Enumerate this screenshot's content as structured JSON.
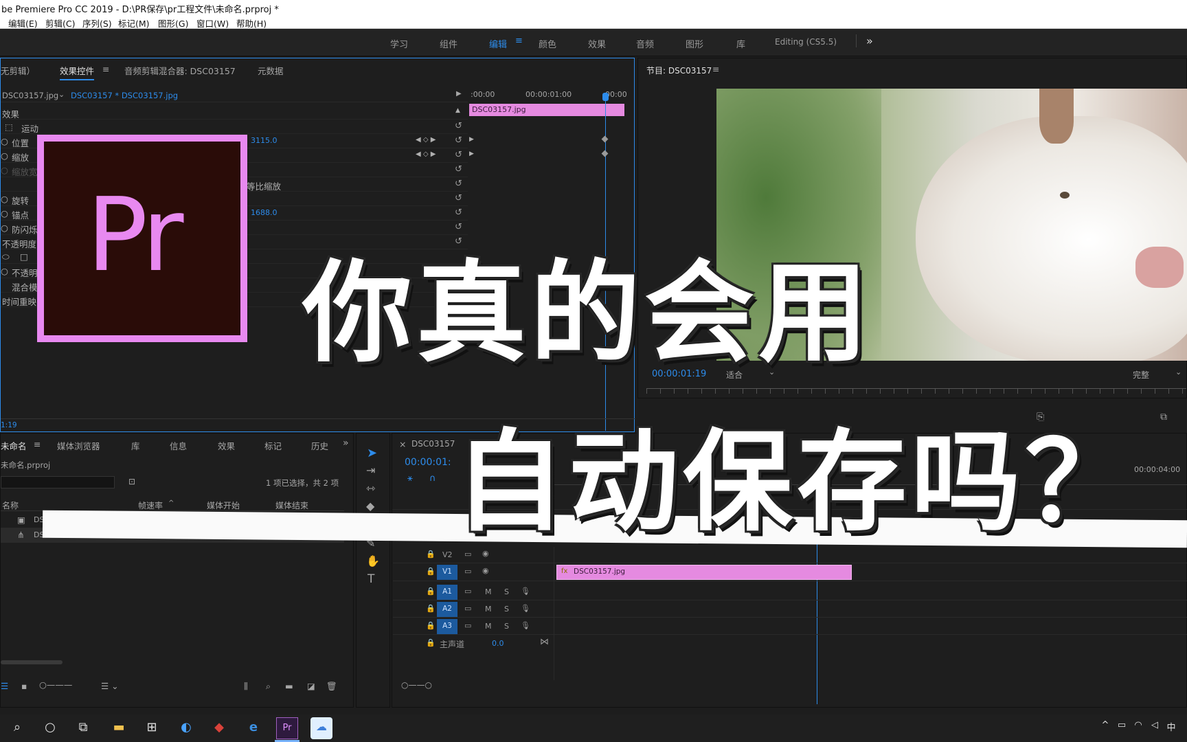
{
  "window": {
    "title": "be Premiere Pro CC 2019 - D:\\PR保存\\pr工程文件\\未命名.prproj *"
  },
  "menu": [
    "编辑(E)",
    "剪辑(C)",
    "序列(S)",
    "标记(M)",
    "图形(G)",
    "窗口(W)",
    "帮助(H)"
  ],
  "workspaces": [
    "学习",
    "组件",
    "编辑",
    "颜色",
    "效果",
    "音频",
    "图形",
    "库",
    "Editing (CS5.5)"
  ],
  "effect_panel": {
    "tabs": [
      "无剪辑）",
      "效果控件",
      "音频剪辑混合器: DSC03157",
      "元数据"
    ],
    "source": "DSC03157.jpg",
    "clip": "DSC03157 * DSC03157.jpg",
    "time_start": ":00:00",
    "time_mid": "00:00:01:00",
    "time_end": "00:00",
    "clip_bar": "DSC03157.jpg",
    "section": "效果",
    "motion": "运动",
    "props": [
      {
        "label": "位置",
        "value": "3115.0"
      },
      {
        "label": "缩放",
        "value": ""
      },
      {
        "label": "缩放宽",
        "value": ""
      },
      {
        "label": "",
        "value": "等比缩放"
      },
      {
        "label": "旋转",
        "value": ""
      },
      {
        "label": "锚点",
        "value": "1688.0"
      },
      {
        "label": "防闪烁",
        "value": ""
      },
      {
        "label": "不透明度",
        "value": ""
      },
      {
        "label": "",
        "value": ""
      },
      {
        "label": "不透明",
        "value": ""
      },
      {
        "label": "混合模",
        "value": ""
      },
      {
        "label": "时间重映",
        "value": ""
      }
    ],
    "timecode": "1:19"
  },
  "program": {
    "title": "节目: DSC03157",
    "timecode": "00:00:01:19",
    "fit": "适合",
    "quality": "完整"
  },
  "project": {
    "tabs": [
      "未命名",
      "媒体浏览器",
      "库",
      "信息",
      "效果",
      "标记",
      "历史"
    ],
    "file": "未命名.prproj",
    "count": "1 项已选择，共 2 项",
    "columns": [
      "名称",
      "帧速率",
      "媒体开始",
      "媒体结束"
    ],
    "items": [
      "DSC",
      "DSC"
    ]
  },
  "timeline": {
    "title": "DSC03157",
    "timecode": "00:00:01:",
    "ruler_end": "00:00:04:00",
    "clip": "DSC03157.jpg",
    "video_tracks": [
      "V2",
      "V1"
    ],
    "audio_tracks": [
      "A1",
      "A2",
      "A3"
    ],
    "mix_label": "主声道",
    "mix_value": "0.0",
    "m": "M",
    "s": "S"
  },
  "overlay": {
    "logo": "Pr",
    "line1": "你真的会用",
    "line2": "自动保存吗？"
  },
  "taskbar": {
    "ime": "中"
  }
}
